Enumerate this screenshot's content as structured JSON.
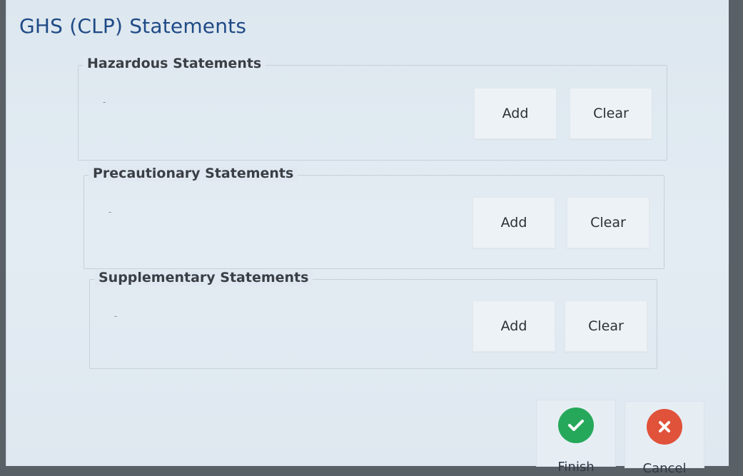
{
  "dialog": {
    "title": "GHS (CLP) Statements"
  },
  "sections": [
    {
      "legend": "Hazardous Statements",
      "value": "-",
      "add_label": "Add",
      "clear_label": "Clear"
    },
    {
      "legend": "Precautionary Statements",
      "value": "-",
      "add_label": "Add",
      "clear_label": "Clear"
    },
    {
      "legend": "Supplementary Statements",
      "value": "-",
      "add_label": "Add",
      "clear_label": "Clear"
    }
  ],
  "footer": {
    "finish_label": "Finish",
    "cancel_label": "Cancel"
  },
  "colors": {
    "title": "#1f4a86",
    "finish": "#26a85a",
    "cancel": "#e0523a"
  },
  "icons": {
    "finish": "check-icon",
    "cancel": "close-icon"
  }
}
